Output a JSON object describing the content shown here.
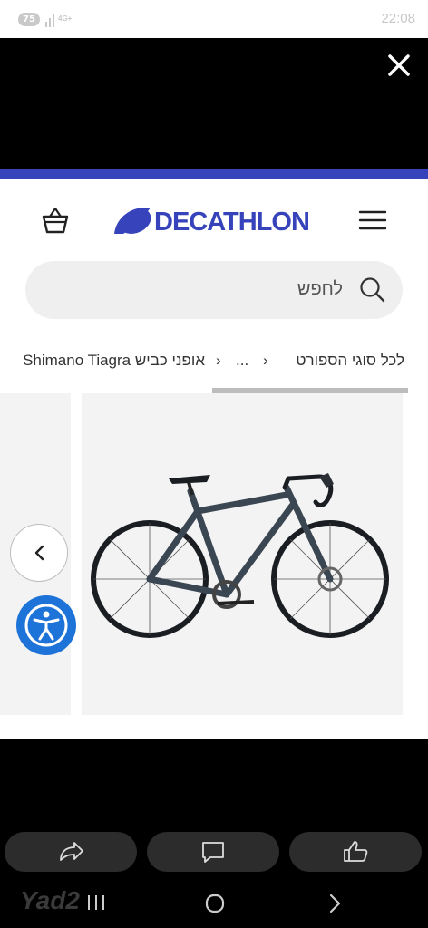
{
  "status_bar": {
    "battery_level": "75",
    "network": "4G+",
    "time": "22:08"
  },
  "header": {
    "brand": "DECATHLON"
  },
  "search": {
    "placeholder": "לחפש"
  },
  "breadcrumb": {
    "item1": "לכל סוגי הספורט",
    "item2": "...",
    "item3": "אופני כביש Shimano Tiagra"
  },
  "colors": {
    "brand_blue": "#3643ba",
    "accessibility_blue": "#1e73d8"
  },
  "icons": {
    "close": "close-icon",
    "cart": "cart-icon",
    "menu": "menu-icon",
    "search": "search-icon",
    "prev": "chevron-left-icon",
    "accessibility": "accessibility-icon",
    "share": "share-icon",
    "chat": "chat-icon",
    "like": "thumbs-up-icon"
  },
  "footer": {
    "watermark": "Yad2"
  }
}
